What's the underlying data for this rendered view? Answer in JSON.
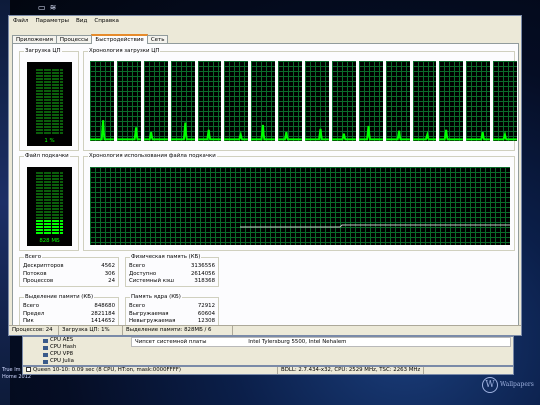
{
  "menubar": [
    "Файл",
    "Параметры",
    "Вид",
    "Справка"
  ],
  "tabs": [
    {
      "label": "Приложения"
    },
    {
      "label": "Процессы"
    },
    {
      "label": "Быстродействие",
      "active": true
    },
    {
      "label": "Сеть"
    }
  ],
  "cpu": {
    "title": "Загрузка ЦП",
    "history_title": "Хронология загрузки ЦП",
    "value": "1 %",
    "level_percent": 1,
    "core_count": 16
  },
  "pagefile": {
    "title": "Файл подкачки",
    "history_title": "Хронология использования файла подкачки",
    "value": "828 МБ",
    "level_percent": 25
  },
  "totals": {
    "title": "Всего",
    "rows": [
      {
        "label": "Дескрипторов",
        "value": "4562"
      },
      {
        "label": "Потоков",
        "value": "306"
      },
      {
        "label": "Процессов",
        "value": "24"
      }
    ]
  },
  "physical": {
    "title": "Физическая память (КБ)",
    "rows": [
      {
        "label": "Всего",
        "value": "3136556"
      },
      {
        "label": "Доступно",
        "value": "2614056"
      },
      {
        "label": "Системный кэш",
        "value": "318368"
      }
    ]
  },
  "commit": {
    "title": "Выделение памяти (КБ)",
    "rows": [
      {
        "label": "Всего",
        "value": "848680"
      },
      {
        "label": "Предел",
        "value": "2821184"
      },
      {
        "label": "Пик",
        "value": "1414652"
      }
    ]
  },
  "kernel": {
    "title": "Память ядра (КБ)",
    "rows": [
      {
        "label": "Всего",
        "value": "72912"
      },
      {
        "label": "Выгружаемая",
        "value": "60604"
      },
      {
        "label": "Невыгружаемая",
        "value": "12308"
      }
    ]
  },
  "statusbar": {
    "processes": "Процессов: 24",
    "cpu": "Загрузка ЦП: 1%",
    "commit": "Выделение памяти: 828МБ / 6"
  },
  "background_window": {
    "tree": [
      "CPU AES",
      "CPU Hash",
      "CPU VP8",
      "CPU Julia"
    ],
    "chipset_label": "Чипсет системной платы",
    "chipset_value": "Intel Tylersburg 5500, Intel Nehalem"
  },
  "bottombar": {
    "left": "Queen 10-10: 0.09 sec (8 CPU, HT:on, mask:0000FFFF)",
    "right": "BDLL: 2.7.434-x32, CPU: 2529 MHz, TSC: 2263 MHz"
  },
  "desktop": {
    "labels": [
      "True Im",
      "Home 2012"
    ],
    "logo_text": "Wallpapers"
  },
  "colors": {
    "graph_line": "#00ff00",
    "graph_grid": "#0a6b2a",
    "pagefile_line": "#c8c8c8",
    "tab_accent": "#e68b2c"
  }
}
